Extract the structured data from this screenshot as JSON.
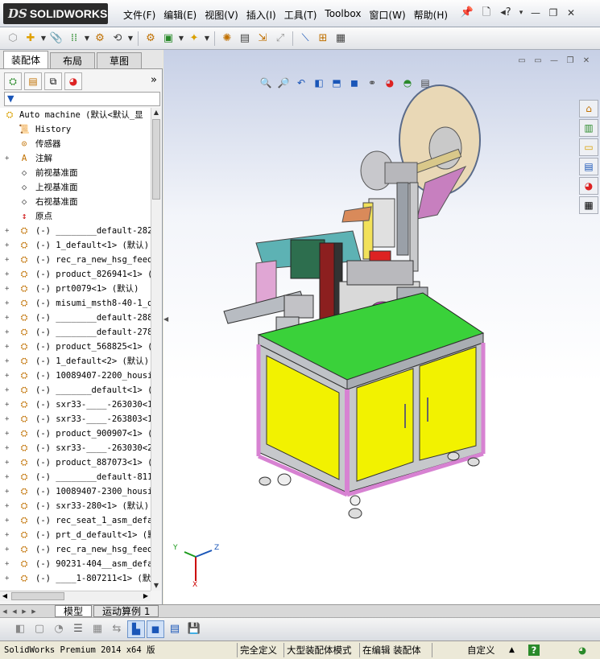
{
  "app": {
    "logo_ds": "DS",
    "logo_name": "SOLIDWORKS"
  },
  "menus": [
    "文件(F)",
    "编辑(E)",
    "视图(V)",
    "插入(I)",
    "工具(T)",
    "Toolbox",
    "窗口(W)",
    "帮助(H)"
  ],
  "title_right": {
    "pin": "📌",
    "new_doc": "🗋",
    "help_drop": "◂?",
    "dropdown": "▾",
    "minimize": "—",
    "restore": "❐",
    "close": "✕"
  },
  "panel": {
    "tabs": [
      "装配体",
      "布局",
      "草图"
    ],
    "active_tab": 0,
    "more": "»",
    "filter": "▼"
  },
  "tree": {
    "root": "Auto machine  (默认<默认_显",
    "items": [
      {
        "icon": "history-icon",
        "glyph": "📜",
        "label": "History",
        "exp": ""
      },
      {
        "icon": "sensor-icon",
        "glyph": "⊙",
        "label": "传感器",
        "exp": ""
      },
      {
        "icon": "annotation-icon",
        "glyph": "A",
        "label": "注解",
        "exp": "+"
      },
      {
        "icon": "plane-icon",
        "glyph": "◇",
        "label": "前视基准面",
        "exp": ""
      },
      {
        "icon": "plane-icon",
        "glyph": "◇",
        "label": "上视基准面",
        "exp": ""
      },
      {
        "icon": "plane-icon",
        "glyph": "◇",
        "label": "右视基准面",
        "exp": ""
      },
      {
        "icon": "origin-icon",
        "glyph": "↕",
        "label": "原点",
        "exp": ""
      },
      {
        "icon": "part-icon",
        "glyph": "⛭",
        "label": "(-) ________default-282",
        "exp": "+"
      },
      {
        "icon": "part-icon",
        "glyph": "⛭",
        "label": "(-) 1_default<1> (默认)",
        "exp": "+"
      },
      {
        "icon": "part-icon",
        "glyph": "⛭",
        "label": "(-) rec_ra_new_hsg_feede",
        "exp": "+"
      },
      {
        "icon": "part-icon",
        "glyph": "⛭",
        "label": "(-) product_826941<1> (",
        "exp": "+"
      },
      {
        "icon": "part-icon",
        "glyph": "⛭",
        "label": "(-) prt0079<1> (默认)",
        "exp": "+"
      },
      {
        "icon": "part-icon",
        "glyph": "⛭",
        "label": "(-) misumi_msth8-40-1_de",
        "exp": "+"
      },
      {
        "icon": "part-icon",
        "glyph": "⛭",
        "label": "(-) ________default-288",
        "exp": "+"
      },
      {
        "icon": "part-icon",
        "glyph": "⛭",
        "label": "(-) ________default-278",
        "exp": "+"
      },
      {
        "icon": "part-icon",
        "glyph": "⛭",
        "label": "(-) product_568825<1> (",
        "exp": "+"
      },
      {
        "icon": "part-icon",
        "glyph": "⛭",
        "label": "(-) 1_default<2> (默认)",
        "exp": "+"
      },
      {
        "icon": "part-icon",
        "glyph": "⛭",
        "label": "(-) 10089407-2200_housir",
        "exp": "+"
      },
      {
        "icon": "part-icon",
        "glyph": "⛭",
        "label": "(-) _______default<1> (",
        "exp": "+"
      },
      {
        "icon": "part-icon",
        "glyph": "⛭",
        "label": "(-) sxr33-____-263030<1",
        "exp": "+"
      },
      {
        "icon": "part-icon",
        "glyph": "⛭",
        "label": "(-) sxr33-____-263803<1",
        "exp": "+"
      },
      {
        "icon": "part-icon",
        "glyph": "⛭",
        "label": "(-) product_900907<1> (",
        "exp": "+"
      },
      {
        "icon": "part-icon",
        "glyph": "⛭",
        "label": "(-) sxr33-____-263030<2",
        "exp": "+"
      },
      {
        "icon": "part-icon",
        "glyph": "⛭",
        "label": "(-) product_887073<1> (",
        "exp": "+"
      },
      {
        "icon": "part-icon",
        "glyph": "⛭",
        "label": "(-) ________default-811",
        "exp": "+"
      },
      {
        "icon": "part-icon",
        "glyph": "⛭",
        "label": "(-) 10089407-2300_housir",
        "exp": "+"
      },
      {
        "icon": "part-icon",
        "glyph": "⛭",
        "label": "(-) sxr33-280<1> (默认)",
        "exp": "+"
      },
      {
        "icon": "part-icon",
        "glyph": "⛭",
        "label": "(-) rec_seat_1_asm_defau",
        "exp": "+"
      },
      {
        "icon": "part-icon",
        "glyph": "⛭",
        "label": "(-) prt_d_default<1> (默",
        "exp": "+"
      },
      {
        "icon": "part-icon",
        "glyph": "⛭",
        "label": "(-) rec_ra_new_hsg_feede",
        "exp": "+"
      },
      {
        "icon": "part-icon",
        "glyph": "⛭",
        "label": "(-) 90231-404__asm_defau",
        "exp": "+"
      },
      {
        "icon": "part-icon",
        "glyph": "⛭",
        "label": "(-) ____1-807211<1> (默认",
        "exp": "+"
      }
    ]
  },
  "bottom_tabs": [
    "模型",
    "运动算例 1"
  ],
  "triad": {
    "y": "Y",
    "z": "Z",
    "x": "X"
  },
  "status": {
    "product": "SolidWorks Premium 2014 x64 版",
    "definition": "完全定义",
    "mode": "大型装配体模式",
    "editing": "在编辑 装配体",
    "units": "自定义",
    "help": "?"
  },
  "colors": {
    "accent": "#1a56b8",
    "logo_bg": "#2b2b2b",
    "table_green": "#3ad13a",
    "cabinet_yellow": "#f2f200",
    "frame_purple": "#d782d2"
  }
}
